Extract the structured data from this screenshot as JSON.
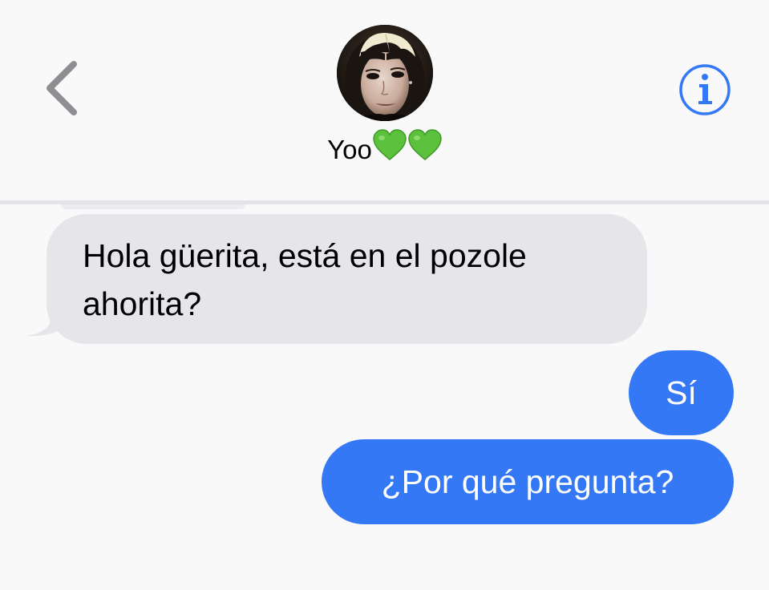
{
  "header": {
    "contact_name": "Yoo",
    "name_emoji": [
      "green-heart",
      "green-heart"
    ],
    "back_icon": "chevron-left-icon",
    "info_icon": "info-icon"
  },
  "messages": [
    {
      "direction": "incoming",
      "text": "Hola güerita, está en el pozole ahorita?"
    },
    {
      "direction": "outgoing",
      "text": "Sí"
    },
    {
      "direction": "outgoing",
      "text": "¿Por qué pregunta?"
    }
  ],
  "colors": {
    "background": "#f9f9f9",
    "incoming_bubble": "#e5e5ea",
    "outgoing_bubble": "#3478f6",
    "accent": "#3478f6",
    "back_chevron": "#8e8e93",
    "heart": "#5cc13c"
  }
}
